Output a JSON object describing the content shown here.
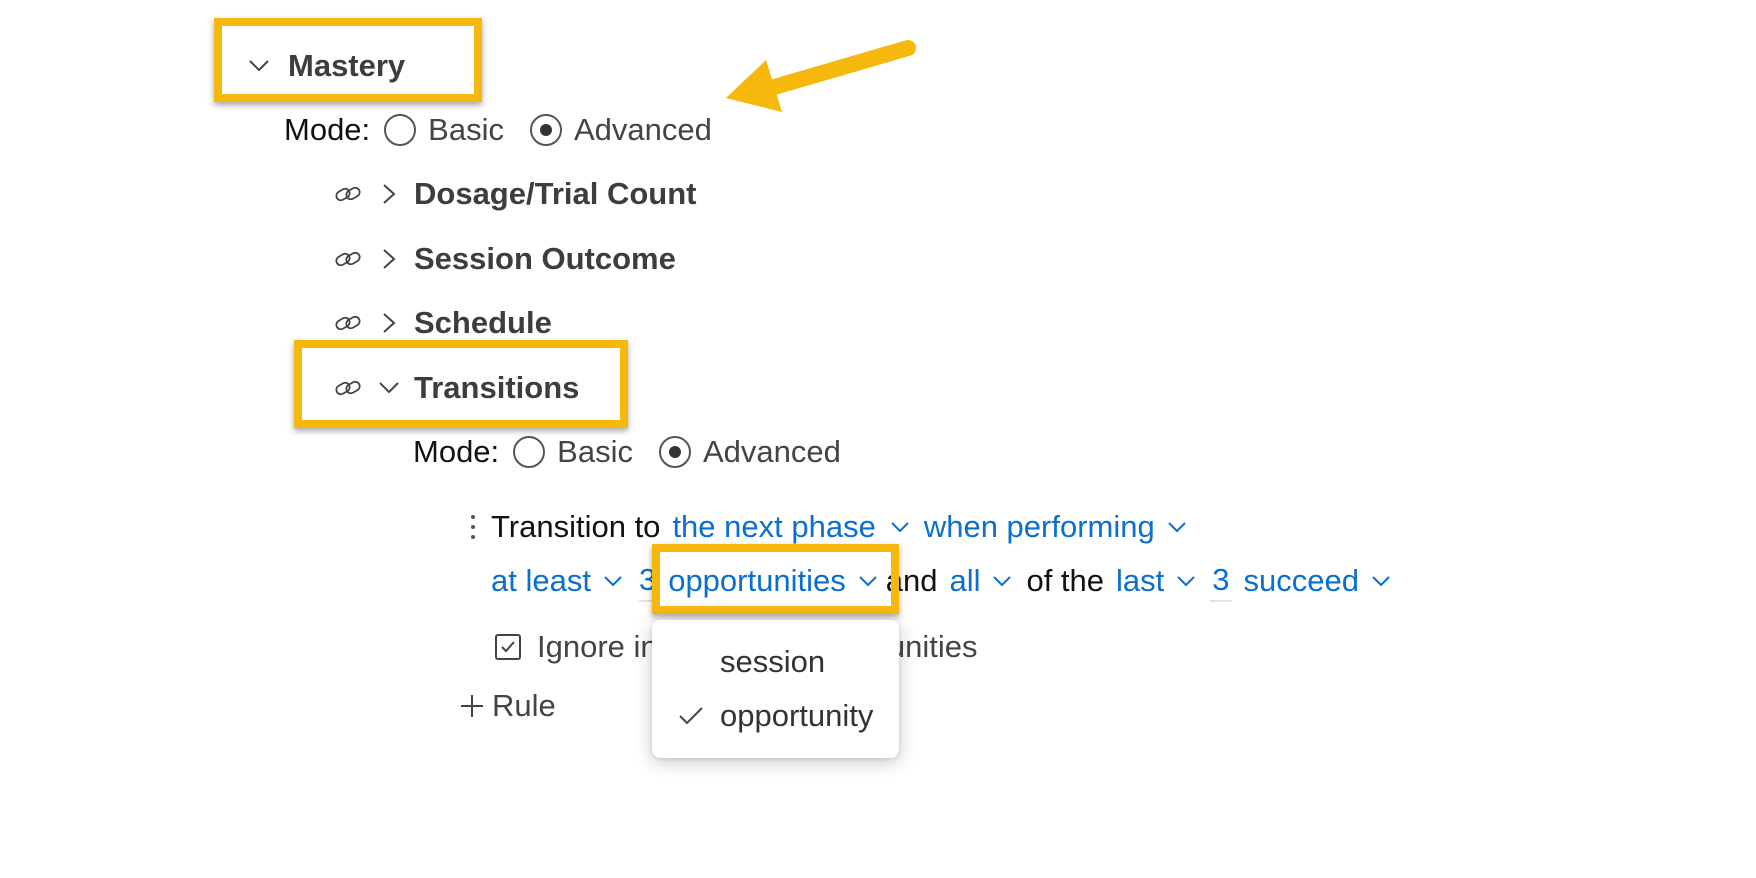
{
  "mastery": {
    "title": "Mastery"
  },
  "mastery_mode": {
    "label": "Mode:",
    "basic": "Basic",
    "advanced": "Advanced",
    "selected": "Advanced"
  },
  "sections": [
    {
      "label": "Dosage/Trial Count",
      "expanded": false
    },
    {
      "label": "Session Outcome",
      "expanded": false
    },
    {
      "label": "Schedule",
      "expanded": false
    },
    {
      "label": "Transitions",
      "expanded": true
    }
  ],
  "transitions_mode": {
    "label": "Mode:",
    "basic": "Basic",
    "advanced": "Advanced",
    "selected": "Advanced"
  },
  "rule": {
    "prefix": "Transition to",
    "target": "the next phase",
    "condition": "when performing",
    "quantifier": "at least",
    "count": "3",
    "unit": "opportunities",
    "and": "and",
    "scope": "all",
    "of_the": "of the",
    "window": "last",
    "window_count": "3",
    "outcome": "succeed",
    "ignore_label_left": "Ignore in",
    "ignore_label_right": "rtunities",
    "ignore_checked": true
  },
  "dropdown": {
    "options": [
      {
        "label": "session",
        "selected": false
      },
      {
        "label": "opportunity",
        "selected": true
      }
    ]
  },
  "add_rule": {
    "label": "Rule"
  },
  "colors": {
    "highlight": "#f6b80c",
    "link_blue": "#0a6fcf"
  }
}
